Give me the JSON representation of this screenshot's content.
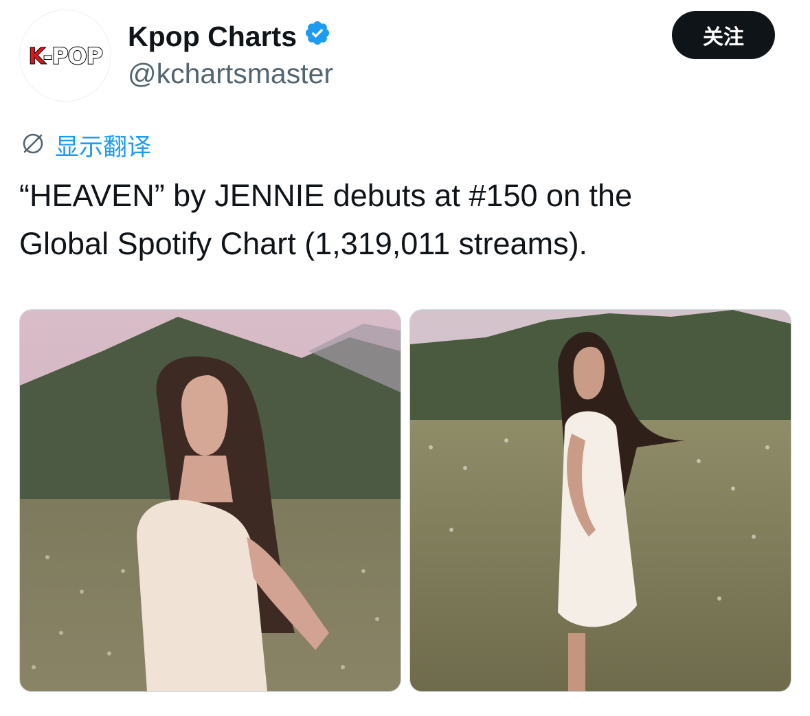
{
  "account": {
    "logo_text_red": "K",
    "logo_text_rest": "-POP",
    "display_name": "Kpop Charts",
    "handle": "@kchartsmaster",
    "verified_icon": "verified-badge-icon",
    "verified_color": "#1d9bf0"
  },
  "follow_button": {
    "label": "关注"
  },
  "translate": {
    "icon": "translate-globe-icon",
    "label": "显示翻译"
  },
  "tweet": {
    "line1": "“HEAVEN” by JENNIE debuts at #150 on the",
    "line2": "Global Spotify Chart (1,319,011 streams)."
  },
  "media": [
    {
      "description_icon": "photo-woman-in-field-mountain-pink-sky"
    },
    {
      "description_icon": "photo-woman-in-field-mountain-reaching-hand"
    }
  ],
  "colors": {
    "text_primary": "#0f1419",
    "text_secondary": "#536471",
    "accent_blue": "#1d9bf0",
    "button_bg": "#0f1419"
  }
}
